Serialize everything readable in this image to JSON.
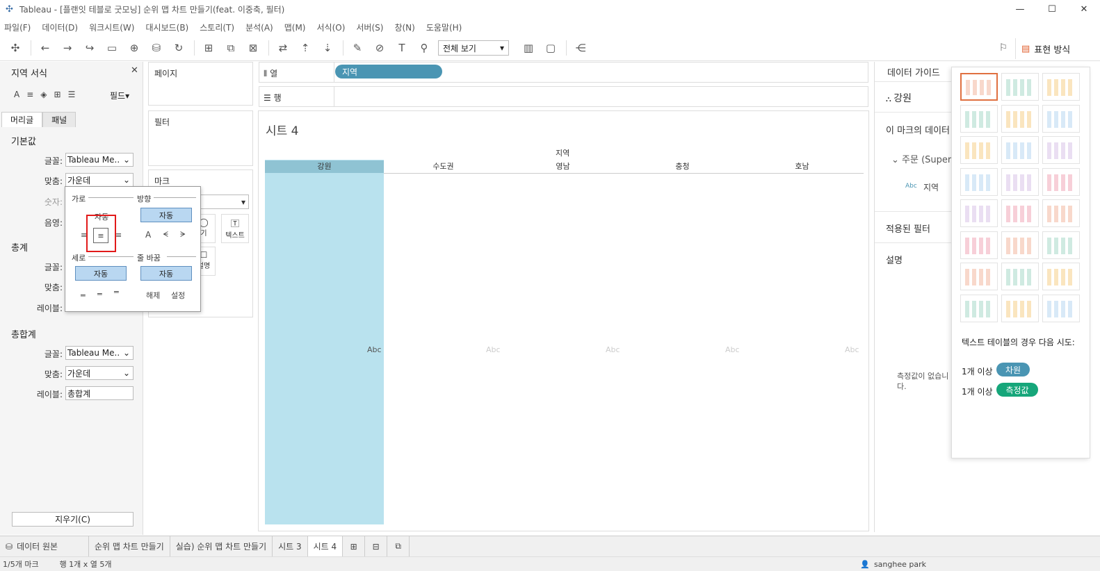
{
  "window": {
    "title": "Tableau - [플랜잇 테블로 굿모닝] 순위 맵 차트 만들기(feat. 이중축, 필터)",
    "controls": [
      "—",
      "☐",
      "✕"
    ]
  },
  "menu": [
    "파일(F)",
    "데이터(D)",
    "워크시트(W)",
    "대시보드(B)",
    "스토리(T)",
    "분석(A)",
    "맵(M)",
    "서식(O)",
    "서버(S)",
    "창(N)",
    "도움말(H)"
  ],
  "toolbar": {
    "view_select": "전체 보기",
    "showme_label": "표현 방식"
  },
  "format_pane": {
    "title": "지역 서식",
    "field_label": "필드",
    "tabs": [
      "머리글",
      "패널"
    ],
    "default_section": "기본값",
    "font_label": "글꼴:",
    "font_value": "Tableau Me..",
    "align_label": "맞춤:",
    "align_value": "가운데",
    "number_label": "숫자:",
    "shade_label": "음영:",
    "totals_section": "총계",
    "label_label": "레이블:",
    "grand_section": "총합계",
    "grand_font_value": "Tableau Me..",
    "grand_align_value": "가운데",
    "grand_label_value": "총합계",
    "clear_button": "지우기(C)"
  },
  "cards": {
    "pages": "페이지",
    "filters": "필터",
    "marks": "마크",
    "text_btn": "텍스트",
    "size_btn": "기",
    "detail_btn": "설명"
  },
  "shelves": {
    "columns": "열",
    "rows": "행",
    "column_pill": "지역"
  },
  "viz": {
    "sheet_title": "시트 4",
    "header_label": "지역",
    "columns": [
      "강원",
      "수도권",
      "영남",
      "충청",
      "호남"
    ],
    "cell_text": "Abc"
  },
  "align_popup": {
    "horizontal": "가로",
    "direction": "방향",
    "auto": "자동",
    "vertical": "세로",
    "wrap": "줄 바꿈",
    "wrap_off": "해제",
    "wrap_on": "설정"
  },
  "data_guide": {
    "title": "데이터 가이드",
    "field": "강원",
    "marks_data": "이 마크의 데이터",
    "order": "주문 (Superstore)",
    "abc": "Abc",
    "region": "지역",
    "applied_filters": "적용된 필터",
    "description": "설명",
    "no_measure": "측정값이 없습니다."
  },
  "showme": {
    "hint": "텍스트 테이블의 경우 다음 시도:",
    "row1_prefix": "1개 이상",
    "row1_badge": "차원",
    "row2_prefix": "1개 이상",
    "row2_badge": "측정값",
    "dim_color": "#4a95b3",
    "measure_color": "#16a67a"
  },
  "bottom_tabs": [
    "데이터 원본",
    "순위 맵 차트 만들기",
    "실습) 순위 맵 차트 만들기",
    "시트 3",
    "시트 4"
  ],
  "status": {
    "marks": "1/5개 마크",
    "rowcol": "행 1개 x 열 5개",
    "user": "sanghee park"
  }
}
